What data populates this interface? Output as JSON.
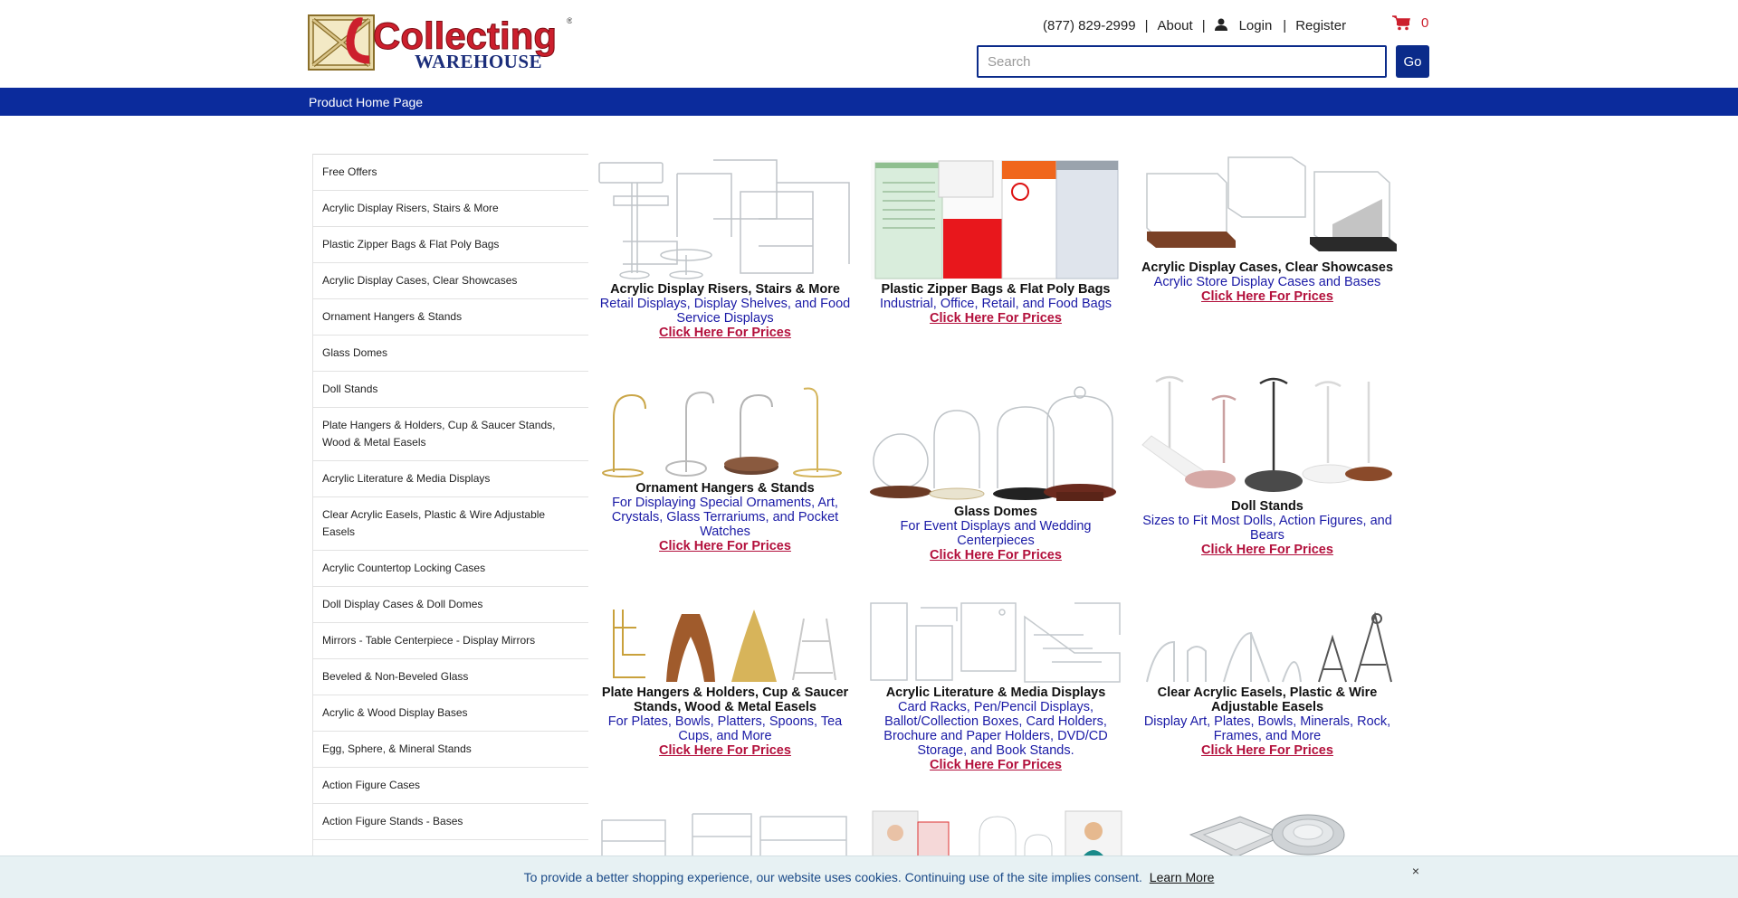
{
  "header": {
    "logo_main": "Collecting",
    "logo_sub": "WAREHOUSE",
    "phone": "(877) 829-2999",
    "about": "About",
    "login": "Login",
    "register": "Register",
    "cart_count": "0",
    "search_placeholder": "Search",
    "go_label": "Go"
  },
  "nav": {
    "home": "Product Home Page"
  },
  "sidebar": {
    "items": [
      "Free Offers",
      "Acrylic Display Risers, Stairs & More",
      "Plastic Zipper Bags & Flat Poly Bags",
      "Acrylic Display Cases, Clear Showcases",
      "Ornament Hangers & Stands",
      "Glass Domes",
      "Doll Stands",
      "Plate Hangers & Holders, Cup & Saucer Stands, Wood & Metal Easels",
      "Acrylic Literature & Media Displays",
      "Clear Acrylic Easels, Plastic & Wire Adjustable Easels",
      "Acrylic Countertop Locking Cases",
      "Doll Display Cases & Doll Domes",
      "Mirrors - Table Centerpiece - Display Mirrors",
      "Beveled & Non-Beveled Glass",
      "Acrylic & Wood Display Bases",
      "Egg, Sphere, & Mineral Stands",
      "Action Figure Cases",
      "Action Figure Stands - Bases"
    ]
  },
  "products": [
    {
      "title": "Acrylic Display Risers, Stairs & More",
      "desc": "Retail Displays, Display Shelves, and Food Service Displays",
      "price": "Click Here For Prices"
    },
    {
      "title": "Plastic Zipper Bags & Flat Poly Bags",
      "desc": "Industrial, Office, Retail, and Food Bags",
      "price": "Click Here For Prices"
    },
    {
      "title": "Acrylic Display Cases, Clear Showcases",
      "desc": "Acrylic Store Display Cases and Bases",
      "price": "Click Here For Prices"
    },
    {
      "title": "Ornament Hangers & Stands",
      "desc": "For Displaying Special Ornaments, Art, Crystals, Glass Terrariums, and Pocket Watches",
      "price": "Click Here For Prices"
    },
    {
      "title": "Glass Domes",
      "desc": "For Event Displays and Wedding Centerpieces",
      "price": "Click Here For Prices"
    },
    {
      "title": "Doll Stands",
      "desc": "Sizes to Fit Most Dolls, Action Figures, and Bears",
      "price": "Click Here For Prices"
    },
    {
      "title": "Plate Hangers & Holders, Cup & Saucer Stands, Wood & Metal Easels",
      "desc": "For Plates, Bowls, Platters, Spoons, Tea Cups, and More",
      "price": "Click Here For Prices"
    },
    {
      "title": "Acrylic Literature & Media Displays",
      "desc": "Card Racks, Pen/Pencil Displays, Ballot/Collection Boxes, Card Holders, Brochure and Paper Holders, DVD/CD Storage, and Book Stands.",
      "price": "Click Here For Prices"
    },
    {
      "title": "Clear Acrylic Easels, Plastic & Wire Adjustable Easels",
      "desc": "Display Art, Plates, Bowls, Minerals, Rock, Frames, and More",
      "price": "Click Here For Prices"
    }
  ],
  "cookie": {
    "text": "To provide a better shopping experience, our website uses cookies. Continuing use of the site implies consent.",
    "learn_more": "Learn More",
    "close": "×"
  },
  "colors": {
    "nav_blue": "#0b2b9c",
    "brand_red": "#cc1f2d",
    "link_blue": "#1a1aa6",
    "price_red": "#b3103c"
  }
}
